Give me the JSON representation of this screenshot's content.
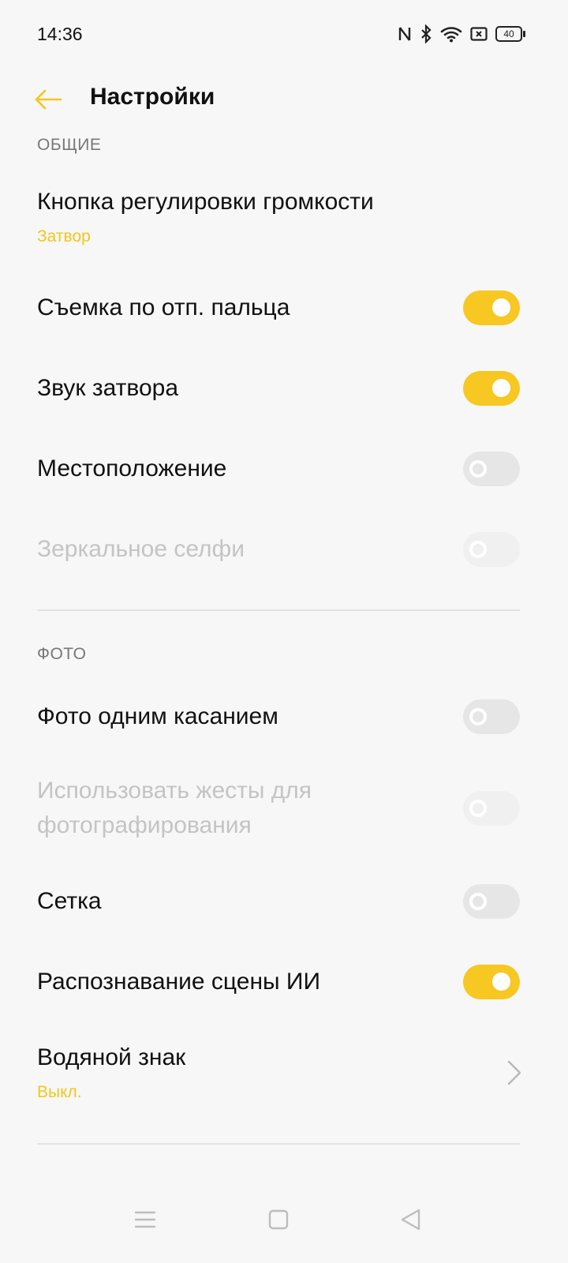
{
  "status_bar": {
    "time": "14:36",
    "battery_level": "40",
    "icons": [
      "nfc-icon",
      "bluetooth-icon",
      "wifi-icon",
      "sim-icon",
      "battery-icon"
    ]
  },
  "app_bar": {
    "title": "Настройки",
    "back_icon": "arrow-left-icon"
  },
  "sections": {
    "general": {
      "header": "ОБЩИЕ",
      "volume_button": {
        "label": "Кнопка регулировки громкости",
        "value": "Затвор"
      },
      "release_capture": {
        "label": "Съемка по отп. пальца",
        "state": "on"
      },
      "shutter_sound": {
        "label": "Звук затвора",
        "state": "on"
      },
      "location": {
        "label": "Местоположение",
        "state": "off"
      },
      "mirror_selfie": {
        "label": "Зеркальное селфи",
        "state": "off",
        "disabled": true
      }
    },
    "photo": {
      "header": "ФОТО",
      "one_touch": {
        "label": "Фото одним касанием",
        "state": "off"
      },
      "gestures": {
        "label_line1": "Использовать жесты для",
        "label_line2": "фотографирования",
        "state": "off",
        "disabled": true
      },
      "grid": {
        "label": "Сетка",
        "state": "off"
      },
      "ai_scene": {
        "label": "Распознавание сцены ИИ",
        "state": "on"
      },
      "watermark": {
        "label": "Водяной знак",
        "value": "Выкл."
      }
    }
  },
  "colors": {
    "accent": "#f7c722",
    "accent_text": "#f3c61d",
    "toggle_off": "#e6e6e6",
    "disabled_text": "#c4c4c4",
    "background": "#f7f7f7"
  },
  "nav_bar": {
    "buttons": [
      "menu-icon",
      "home-square-icon",
      "back-triangle-icon"
    ]
  }
}
